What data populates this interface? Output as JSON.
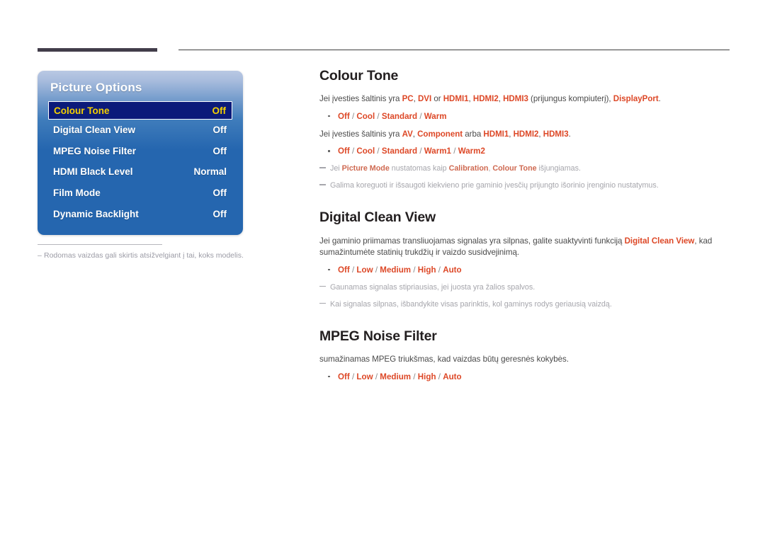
{
  "page": {
    "top_rule": "decorative-rule"
  },
  "osd": {
    "title": "Picture Options",
    "rows": [
      {
        "label": "Colour Tone",
        "value": "Off",
        "selected": true
      },
      {
        "label": "Digital Clean View",
        "value": "Off",
        "selected": false
      },
      {
        "label": "MPEG Noise Filter",
        "value": "Off",
        "selected": false
      },
      {
        "label": "HDMI Black Level",
        "value": "Normal",
        "selected": false
      },
      {
        "label": "Film Mode",
        "value": "Off",
        "selected": false
      },
      {
        "label": "Dynamic Backlight",
        "value": "Off",
        "selected": false
      }
    ],
    "footnote": "Rodomas vaizdas gali skirtis atsižvelgiant į tai, koks modelis.",
    "footnote_dash": "–",
    "colors": {
      "panel_blue": "#2566af",
      "panel_top": "#b9c8e3",
      "selected_bg": "#0b1a7a",
      "selected_text": "#f5d000"
    }
  },
  "sections": {
    "colour_tone": {
      "title": "Colour Tone",
      "p1": {
        "a": "Jei įvesties šaltinis yra ",
        "kw1": "PC",
        "b": ", ",
        "kw2": "DVI",
        "c": " or ",
        "kw3": "HDMI1",
        "d": ", ",
        "kw4": "HDMI2",
        "e": ", ",
        "kw5": "HDMI3",
        "f": " (prijungus kompiuterį), ",
        "kw6": "DisplayPort",
        "g": "."
      },
      "opts1": {
        "o1": "Off",
        "o2": "Cool",
        "o3": "Standard",
        "o4": "Warm"
      },
      "p2": {
        "a": "Jei įvesties šaltinis yra ",
        "kw1": "AV",
        "b": ", ",
        "kw2": "Component",
        "c": " arba ",
        "kw3": "HDMI1",
        "d": ", ",
        "kw4": "HDMI2",
        "e": ", ",
        "kw5": "HDMI3",
        "f": "."
      },
      "opts2": {
        "o1": "Off",
        "o2": "Cool",
        "o3": "Standard",
        "o4": "Warm1",
        "o5": "Warm2"
      },
      "note1": {
        "a": "Jei ",
        "kw1": "Picture Mode",
        "b": " nustatomas kaip ",
        "kw2": "Calibration",
        "c": ", ",
        "kw3": "Colour Tone",
        "d": " išjungiamas."
      },
      "note2": "Galima koreguoti ir išsaugoti kiekvieno prie gaminio įvesčių prijungto išorinio įrenginio nustatymus."
    },
    "digital_clean_view": {
      "title": "Digital Clean View",
      "p1": {
        "a": "Jei gaminio priimamas transliuojamas signalas yra silpnas, galite suaktyvinti funkciją ",
        "kw1": "Digital Clean View",
        "b": ", kad sumažintumėte statinių trukdžių ir vaizdo susidvejinimą."
      },
      "opts": {
        "o1": "Off",
        "o2": "Low",
        "o3": "Medium",
        "o4": "High",
        "o5": "Auto"
      },
      "note1": "Gaunamas signalas stipriausias, jei juosta yra žalios spalvos.",
      "note2": "Kai signalas silpnas, išbandykite visas parinktis, kol gaminys rodys geriausią vaizdą."
    },
    "mpeg_noise_filter": {
      "title": "MPEG Noise Filter",
      "p1": "sumažinamas MPEG triukšmas, kad vaizdas būtų geresnės kokybės.",
      "opts": {
        "o1": "Off",
        "o2": "Low",
        "o3": "Medium",
        "o4": "High",
        "o5": "Auto"
      }
    }
  },
  "separator": " / "
}
